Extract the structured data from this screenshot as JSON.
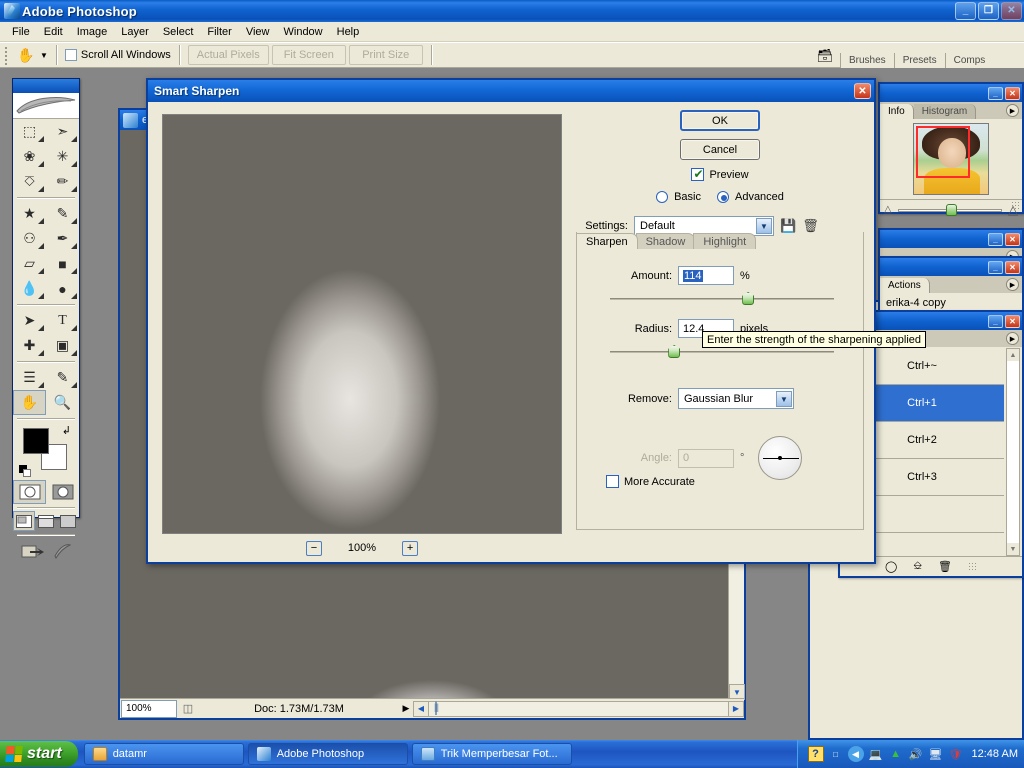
{
  "app": {
    "title": "Adobe Photoshop",
    "logo_icon": "photoshop-logo-icon",
    "window_buttons": {
      "minimize": "_",
      "maximize": "❐",
      "close": "✕"
    },
    "menus": [
      "File",
      "Edit",
      "Image",
      "Layer",
      "Select",
      "Filter",
      "View",
      "Window",
      "Help"
    ]
  },
  "options_bar": {
    "tool_icon": "hand-tool-icon",
    "dropdown_icon": "chevron-down-icon",
    "scroll_all_windows_label": "Scroll All Windows",
    "scroll_all_windows_checked": false,
    "buttons": [
      "Actual Pixels",
      "Fit Screen",
      "Print Size"
    ],
    "well_icon": "palette-well-icon"
  },
  "toolbox": {
    "tools": [
      {
        "name": "rectangular-marquee-tool",
        "glyph": "⬚"
      },
      {
        "name": "move-tool",
        "glyph": "➤"
      },
      {
        "name": "lasso-tool",
        "glyph": "❀"
      },
      {
        "name": "magic-wand-tool",
        "glyph": "✳"
      },
      {
        "name": "crop-tool",
        "glyph": "⌧"
      },
      {
        "name": "slice-tool",
        "glyph": "✐"
      },
      {
        "name": "healing-brush-tool",
        "glyph": "✐"
      },
      {
        "name": "brush-tool",
        "glyph": "✎"
      },
      {
        "name": "clone-stamp-tool",
        "glyph": "☗"
      },
      {
        "name": "history-brush-tool",
        "glyph": "✒"
      },
      {
        "name": "eraser-tool",
        "glyph": "▱"
      },
      {
        "name": "gradient-tool",
        "glyph": "■"
      },
      {
        "name": "blur-tool",
        "glyph": "●"
      },
      {
        "name": "dodge-tool",
        "glyph": "●"
      },
      {
        "name": "path-selection-tool",
        "glyph": "➤"
      },
      {
        "name": "type-tool",
        "glyph": "T"
      },
      {
        "name": "pen-tool",
        "glyph": "✒"
      },
      {
        "name": "rectangle-tool",
        "glyph": "▣"
      },
      {
        "name": "notes-tool",
        "glyph": "☰"
      },
      {
        "name": "eyedropper-tool",
        "glyph": "✐"
      },
      {
        "name": "hand-tool",
        "glyph": "✋"
      },
      {
        "name": "zoom-tool",
        "glyph": "⚲"
      }
    ],
    "selected_tool": "hand-tool",
    "foreground_color": "#000000",
    "background_color": "#ffffff",
    "swap_icon": "swap-colors-icon",
    "default_colors_icon": "default-colors-icon",
    "quick_mask": [
      "standard-mode-icon",
      "quick-mask-mode-icon"
    ],
    "screen_modes": [
      "standard-screen-icon",
      "full-screen-menubar-icon",
      "full-screen-icon"
    ],
    "jump_to_imageready": "jump-to-imageready-icon"
  },
  "document": {
    "title": "e",
    "icon": "document-icon",
    "zoom": "100%",
    "doc_info": "Doc: 1.73M/1.73M",
    "status_icon": "preview-info-icon",
    "arrow_icon": "play-arrow-icon"
  },
  "palette_well": {
    "tabs": [
      "Brushes",
      "Presets",
      "Comps"
    ]
  },
  "navigator": {
    "tabs": [
      "Info",
      "Histogram"
    ],
    "active_tab": "Info",
    "menu_icon": "palette-menu-icon",
    "zoom_out_icon": "zoom-out-icon",
    "zoom_in_icon": "zoom-in-icon",
    "view_box_color": "#ff2a2a"
  },
  "actions_palette": {
    "tabs": [
      "Actions"
    ],
    "menu_icon": "palette-menu-icon"
  },
  "layers_palette": {
    "layer_name": "erika-4 copy",
    "rows": [
      {
        "label": "Ctrl+~",
        "selected": false
      },
      {
        "label": "Ctrl+1",
        "selected": true
      },
      {
        "label": "Ctrl+2",
        "selected": false
      },
      {
        "label": "Ctrl+3",
        "selected": false
      }
    ],
    "footer_icons": [
      "new-set-icon",
      "new-action-icon",
      "delete-icon"
    ],
    "scroll_up_icon": "scroll-up-icon",
    "scroll_down_icon": "scroll-down-icon"
  },
  "dialog": {
    "title": "Smart Sharpen",
    "close_icon": "close-icon",
    "ok_label": "OK",
    "cancel_label": "Cancel",
    "preview_label": "Preview",
    "preview_checked": true,
    "mode_basic_label": "Basic",
    "mode_advanced_label": "Advanced",
    "mode_selected": "Advanced",
    "settings_label": "Settings:",
    "settings_value": "Default",
    "settings_dropdown_icon": "chevron-down-icon",
    "save_preset_icon": "save-icon",
    "delete_preset_icon": "trash-icon",
    "tabs": [
      "Sharpen",
      "Shadow",
      "Highlight"
    ],
    "active_tab": "Sharpen",
    "amount_label": "Amount:",
    "amount_value": "114",
    "amount_unit": "%",
    "amount_slider_pct": 62,
    "radius_label": "Radius:",
    "radius_value": "12.4",
    "radius_unit": "pixels",
    "radius_slider_pct": 31,
    "remove_label": "Remove:",
    "remove_value": "Gaussian Blur",
    "remove_dropdown_icon": "chevron-down-icon",
    "angle_label": "Angle:",
    "angle_value": "0",
    "angle_unit": "°",
    "angle_dial_icon": "angle-dial-icon",
    "more_accurate_label": "More Accurate",
    "more_accurate_checked": false,
    "zoom_out_label": "−",
    "zoom_in_label": "+",
    "zoom_value": "100%",
    "tooltip_text": "Enter the strength of the sharpening applied"
  },
  "taskbar": {
    "start_label": "start",
    "start_icon": "windows-flag-icon",
    "tasks": [
      {
        "label": "datamr",
        "icon": "folder-icon",
        "active": false
      },
      {
        "label": "Adobe Photoshop",
        "icon": "photoshop-icon",
        "active": true
      },
      {
        "label": "Trik Memperbesar Fot...",
        "icon": "word-document-icon",
        "active": false
      }
    ],
    "tray_icons": [
      "help-icon",
      "network-dropdown-icon",
      "show-hidden-icon",
      "network-disconnected-icon",
      "antivirus-icon",
      "volume-icon",
      "display-icon",
      "security-center-icon"
    ],
    "clock": "12:48 AM"
  },
  "colors": {
    "accent": "#0a51b8",
    "face": "#ece9d8",
    "desktop": "#868686",
    "selection": "#2f6fd0",
    "tooltip_bg": "#ffffe1"
  }
}
